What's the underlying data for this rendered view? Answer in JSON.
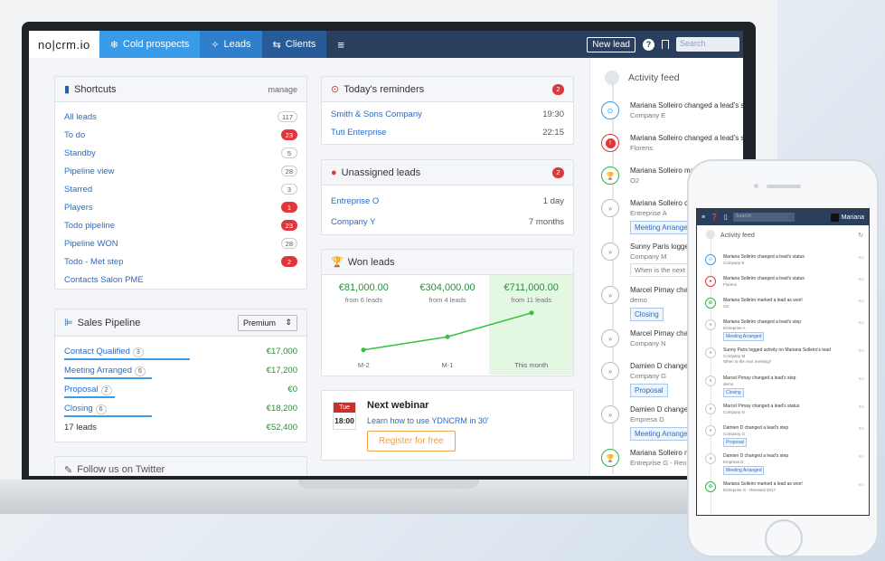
{
  "nav": {
    "logo": "no|crm.io",
    "tabs": [
      "Cold prospects",
      "Leads",
      "Clients"
    ],
    "new_lead": "New lead",
    "search_placeholder": "Search"
  },
  "shortcuts": {
    "title": "Shortcuts",
    "manage": "manage",
    "items": [
      {
        "label": "All leads",
        "count": "117",
        "red": false
      },
      {
        "label": "To do",
        "count": "23",
        "red": true
      },
      {
        "label": "Standby",
        "count": "5",
        "red": false
      },
      {
        "label": "Pipeline view",
        "count": "28",
        "red": false
      },
      {
        "label": "Starred",
        "count": "3",
        "red": false
      },
      {
        "label": "Players",
        "count": "1",
        "red": true
      },
      {
        "label": "Todo pipeline",
        "count": "23",
        "red": true
      },
      {
        "label": "Pipeline WON",
        "count": "28",
        "red": false
      },
      {
        "label": "Todo - Met step",
        "count": "2",
        "red": true
      },
      {
        "label": "Contacts Salon PME",
        "count": "",
        "red": false
      }
    ]
  },
  "pipeline": {
    "title": "Sales Pipeline",
    "select": "Premium",
    "rows": [
      {
        "label": "Contact Qualified",
        "count": "3",
        "value": "€17,000",
        "bar": 0.5
      },
      {
        "label": "Meeting Arranged",
        "count": "6",
        "value": "€17,200",
        "bar": 0.35
      },
      {
        "label": "Proposal",
        "count": "2",
        "value": "€0",
        "bar": 0.2
      },
      {
        "label": "Closing",
        "count": "6",
        "value": "€18,200",
        "bar": 0.35
      }
    ],
    "total_label": "17 leads",
    "total_value": "€52,400"
  },
  "twitter": {
    "title": "Follow us on Twitter"
  },
  "reminders": {
    "title": "Today's reminders",
    "badge": "2",
    "items": [
      {
        "label": "Smith & Sons Company",
        "time": "19:30"
      },
      {
        "label": "Tuti Enterprise",
        "time": "22:15"
      }
    ]
  },
  "unassigned": {
    "title": "Unassigned leads",
    "badge": "2",
    "items": [
      {
        "label": "Entreprise O",
        "age": "1 day"
      },
      {
        "label": "Company Y",
        "age": "7 months"
      }
    ]
  },
  "won": {
    "title": "Won leads",
    "cols": [
      {
        "amount": "€81,000.00",
        "sub": "from 6 leads",
        "label": "M-2"
      },
      {
        "amount": "€304,000.00",
        "sub": "from 4 leads",
        "label": "M-1"
      },
      {
        "amount": "€711,000.00",
        "sub": "from 11 leads",
        "label": "This month"
      }
    ]
  },
  "chart_data": {
    "type": "line",
    "categories": [
      "M-2",
      "M-1",
      "This month"
    ],
    "values": [
      81000,
      304000,
      711000
    ]
  },
  "webinar": {
    "day": "Tue",
    "time": "18:00",
    "title": "Next webinar",
    "link": "Learn how to use YDNCRM in 30'",
    "button": "Register for free"
  },
  "feed": {
    "title": "Activity feed",
    "items": [
      {
        "text": "Mariana Solleiro changed a lead's sta",
        "sub": "Company E",
        "icon": "blue",
        "tag": ""
      },
      {
        "text": "Mariana Solleiro changed a lead's st",
        "sub": "Florens",
        "icon": "red",
        "tag": ""
      },
      {
        "text": "Mariana Solleiro mar",
        "sub": "O2",
        "icon": "green",
        "tag": ""
      },
      {
        "text": "Mariana Solleiro cl",
        "sub": "Entreprise A",
        "icon": "gray",
        "tag": "Meeting Arrange"
      },
      {
        "text": "Sunny Paris logge",
        "sub": "Company M",
        "icon": "gray",
        "tag": "",
        "note": "When is the next"
      },
      {
        "text": "Marcel Pirnay cha",
        "sub": "demo",
        "icon": "gray",
        "tag": "Closing"
      },
      {
        "text": "Marcel Pirnay cha",
        "sub": "Company N",
        "icon": "gray",
        "tag": ""
      },
      {
        "text": "Damien D change",
        "sub": "Company G",
        "icon": "gray",
        "tag": "Proposal"
      },
      {
        "text": "Damien D change",
        "sub": "Empresa D",
        "icon": "gray",
        "tag": "Meeting Arrange"
      },
      {
        "text": "Mariana Solleiro m",
        "sub": "Entreprise G - Ren",
        "icon": "green",
        "tag": ""
      }
    ]
  },
  "mobile": {
    "user": "Mariana",
    "search_placeholder": "Search",
    "title": "Activity feed",
    "items": [
      {
        "text": "Mariana Solleiro changed a lead's status",
        "sub": "Company E",
        "icon": "blue",
        "tag": "",
        "time": "9m"
      },
      {
        "text": "Mariana Solleiro changed a lead's status",
        "sub": "Florens",
        "icon": "red",
        "tag": "",
        "time": "9m"
      },
      {
        "text": "Mariana Solleiro marked a lead as won!",
        "sub": "O2",
        "icon": "green",
        "tag": "",
        "time": "9m"
      },
      {
        "text": "Mariana Solleiro changed a lead's step",
        "sub": "Entreprise A",
        "icon": "gray",
        "tag": "Meeting Arranged",
        "time": "9m"
      },
      {
        "text": "Sunny Paris logged activity on Mariana Solleiro's lead",
        "sub": "Company M",
        "icon": "gray",
        "tag": "",
        "note": "When is the next meeting?",
        "time": "9m"
      },
      {
        "text": "Marcel Pirnay changed a lead's step",
        "sub": "demo",
        "icon": "gray",
        "tag": "Closing",
        "time": "9m"
      },
      {
        "text": "Marcel Pirnay changed a lead's status",
        "sub": "Company N",
        "icon": "gray",
        "tag": "",
        "time": "9m"
      },
      {
        "text": "Damien D changed a lead's step",
        "sub": "Company G",
        "icon": "gray",
        "tag": "Proposal",
        "time": "9m"
      },
      {
        "text": "Damien D changed a lead's step",
        "sub": "Empresa D",
        "icon": "gray",
        "tag": "Meeting Arranged",
        "time": "9m"
      },
      {
        "text": "Mariana Solleiro marked a lead as won!",
        "sub": "Entreprise G - Renewal 2017",
        "icon": "green",
        "tag": "",
        "time": "9m"
      }
    ]
  }
}
